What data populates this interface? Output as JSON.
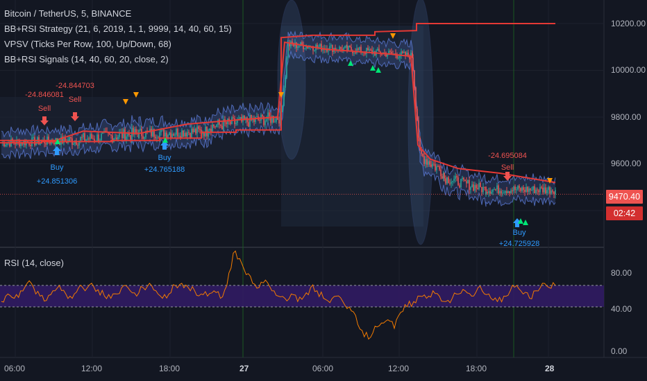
{
  "legend": {
    "title": "Bitcoin / TetherUS, 5, BINANCE",
    "ind1": "BB+RSI Strategy (21, 6, 2019, 1, 1, 9999, 14, 40, 60, 15)",
    "ind2": "VPSV (Ticks Per Row, 100, Up/Down, 68)",
    "ind3": "BB+RSI Signals (14, 40, 60, 20, close, 2)",
    "rsi": "RSI (14, close)"
  },
  "price_axis": {
    "ticks": [
      "10200.00",
      "10000.00",
      "9800.00",
      "9600.00"
    ],
    "partial": "94"
  },
  "rsi_axis": {
    "ticks": [
      "80.00",
      "40.00",
      "0.00"
    ]
  },
  "time_axis": {
    "ticks": [
      "06:00",
      "12:00",
      "18:00",
      "27",
      "06:00",
      "12:00",
      "18:00",
      "28"
    ]
  },
  "price_tags": {
    "last": "9470.40",
    "countdown": "02:42"
  },
  "signals": [
    {
      "kind": "sell",
      "label": "Sell",
      "value": "-24.846081"
    },
    {
      "kind": "sell",
      "label": "Sell",
      "value": "-24.844703"
    },
    {
      "kind": "buy",
      "label": "Buy",
      "value": "+24.851306"
    },
    {
      "kind": "buy",
      "label": "Buy",
      "value": "+24.765188"
    },
    {
      "kind": "sell",
      "label": "Sell",
      "value": "-24.695084"
    },
    {
      "kind": "buy",
      "label": "Buy",
      "value": "+24.725928"
    }
  ],
  "colors": {
    "background": "#131722",
    "candle_up": "#26a69a",
    "candle_down": "#ef5350",
    "band": "#5b7bd6",
    "strategy_line": "#e53935",
    "rsi_line": "#f57c00",
    "rsi_band": "#311b63",
    "buy": "#2f9bff",
    "sell": "#ef5350",
    "triangle_up": "#00e676",
    "triangle_down": "#ff9800"
  },
  "chart_data": {
    "type": "line",
    "price": {
      "x": [
        "05:00",
        "06:00",
        "08:00",
        "10:00",
        "12:00",
        "14:00",
        "16:00",
        "18:00",
        "20:00",
        "22:00",
        "27 00:00",
        "01:00",
        "02:00",
        "04:00",
        "06:00",
        "08:00",
        "10:00",
        "12:00",
        "13:00",
        "14:00",
        "16:00",
        "18:00",
        "20:00",
        "22:00",
        "23:30"
      ],
      "close": [
        9680,
        9700,
        9690,
        9720,
        9730,
        9700,
        9740,
        9720,
        9760,
        9800,
        9780,
        9800,
        10120,
        10100,
        10090,
        10060,
        10070,
        10060,
        10050,
        9640,
        9520,
        9500,
        9490,
        9480,
        9470
      ],
      "ylim": [
        9400,
        10300
      ]
    },
    "strategy_line": {
      "x": [
        "05:00",
        "08:00",
        "12:00",
        "15:00",
        "18:00",
        "21:00",
        "27 01:00",
        "02:00",
        "06:00",
        "10:00",
        "12:00",
        "13:00",
        "16:00",
        "20:00",
        "23:30"
      ],
      "y": [
        9690,
        9690,
        9695,
        9695,
        9700,
        9720,
        9740,
        10150,
        10160,
        10160,
        10180,
        10200,
        10200,
        10200,
        10200
      ]
    },
    "rsi": {
      "ylim": [
        0,
        100
      ],
      "upper_band": 60,
      "lower_band": 40,
      "values": [
        45,
        52,
        48,
        55,
        62,
        58,
        50,
        46,
        55,
        60,
        52,
        48,
        58,
        55,
        62,
        56,
        50,
        48,
        52,
        60,
        55,
        50,
        58,
        62,
        55,
        48,
        52,
        60,
        62,
        58,
        55,
        52,
        50,
        55,
        48,
        60,
        90,
        85,
        70,
        62,
        58,
        65,
        55,
        50,
        48,
        52,
        45,
        50,
        58,
        55,
        48,
        44,
        50,
        45,
        40,
        32,
        18,
        10,
        22,
        25,
        28,
        20,
        35,
        40,
        45,
        50,
        48,
        55,
        50,
        45,
        48,
        52,
        55,
        50,
        58,
        52,
        48,
        45,
        50,
        55,
        60,
        52,
        48,
        55,
        62,
        58,
        60
      ]
    }
  }
}
